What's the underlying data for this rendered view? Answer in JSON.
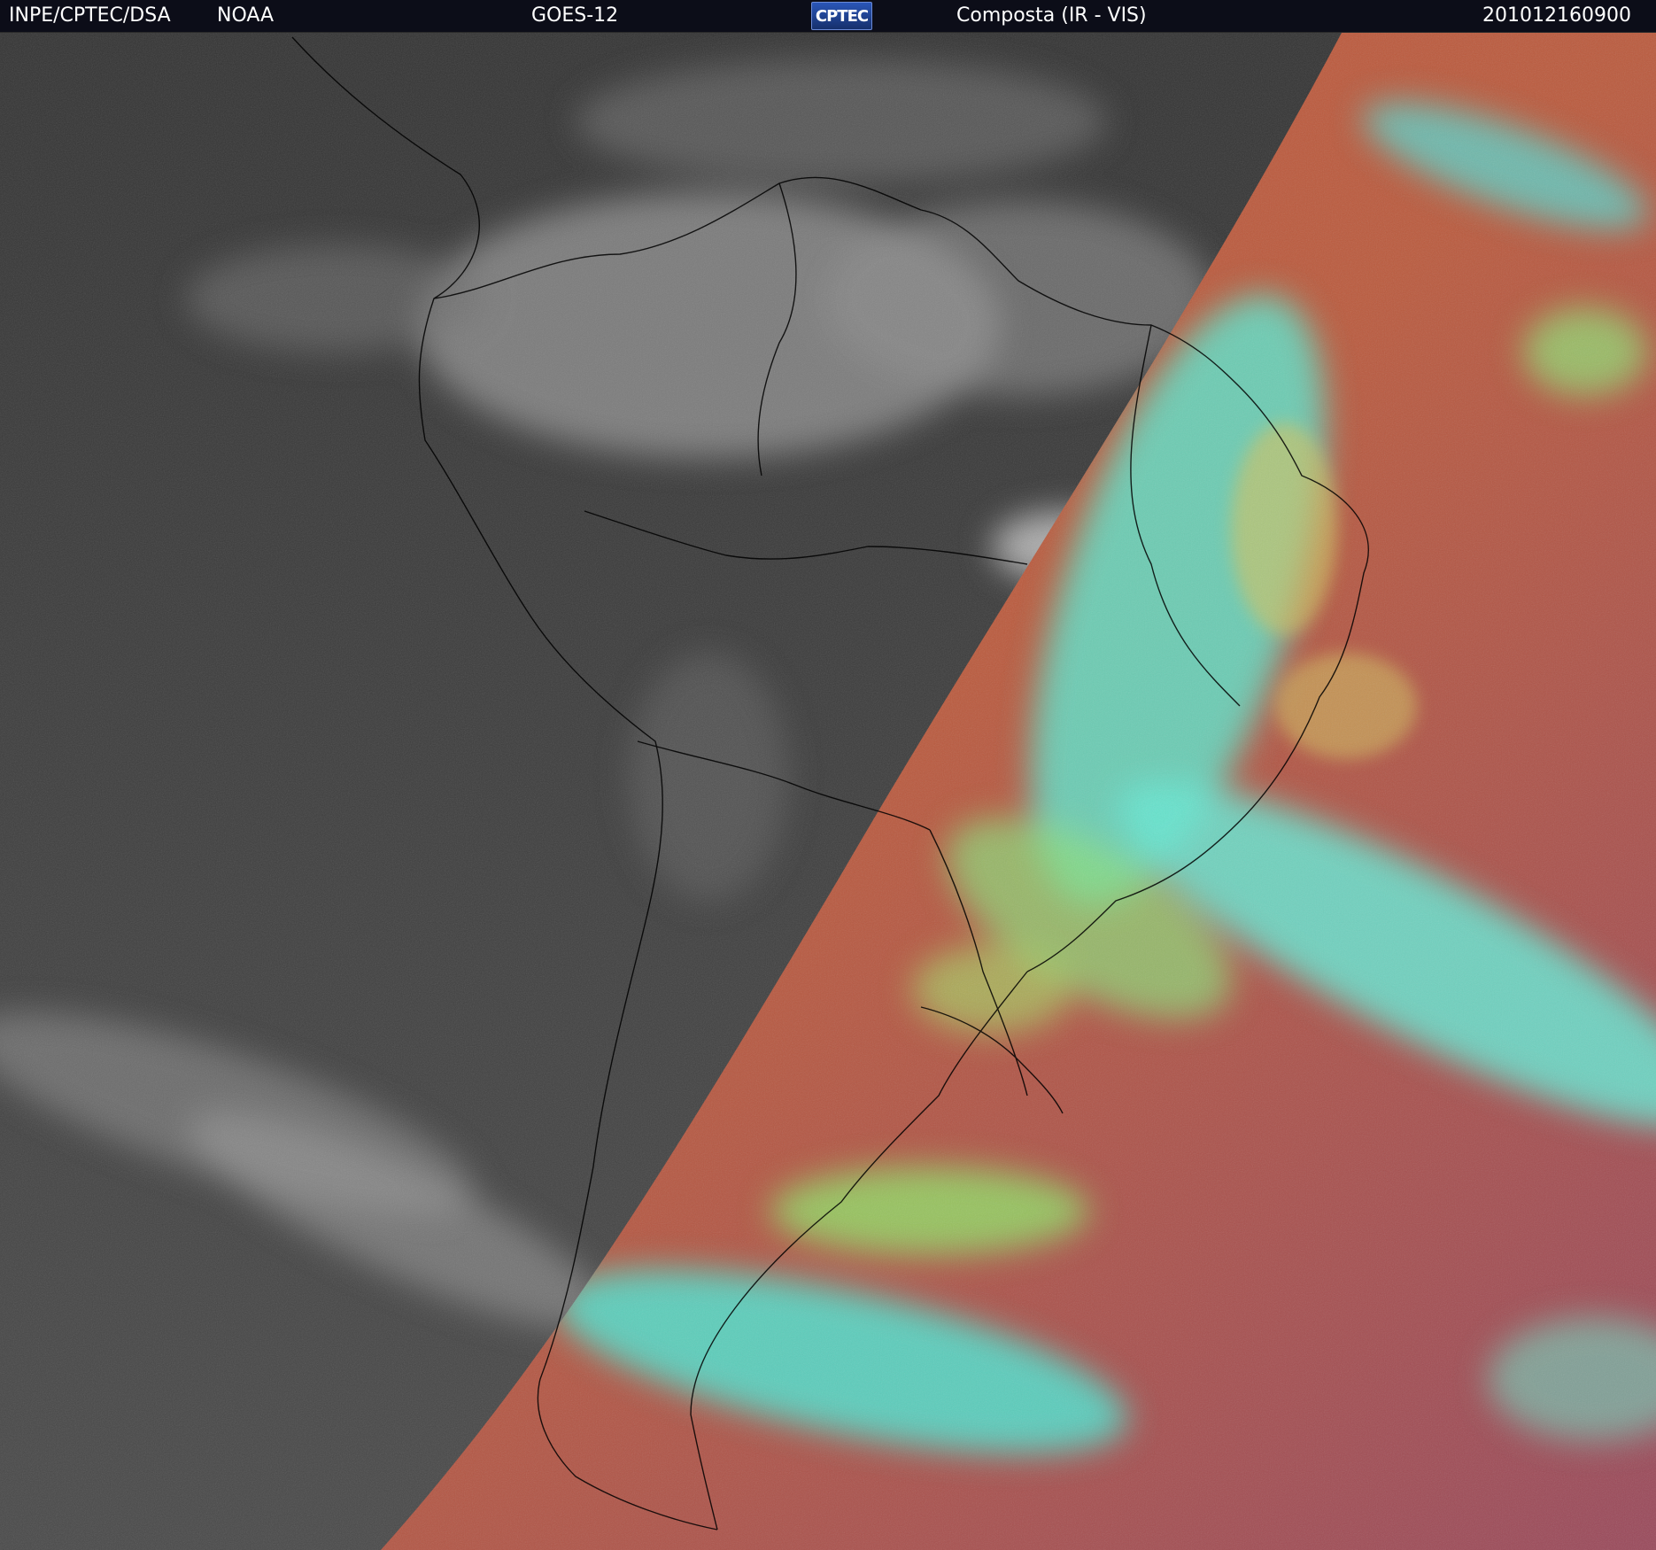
{
  "header": {
    "organization": "INPE/CPTEC/DSA",
    "agency": "NOAA",
    "satellite": "GOES-12",
    "logo_text": "CPTEC",
    "product": "Composta (IR - VIS)",
    "timestamp": "201012160900"
  },
  "colors": {
    "header_bg": "#0c0d18",
    "night_gray": "#3d3d3d",
    "day_red": "#b8533b",
    "cloud_cyan": "#46e6d6",
    "cloud_green": "#92ea6c"
  },
  "icons": {
    "logo": "cptec-logo-icon"
  }
}
